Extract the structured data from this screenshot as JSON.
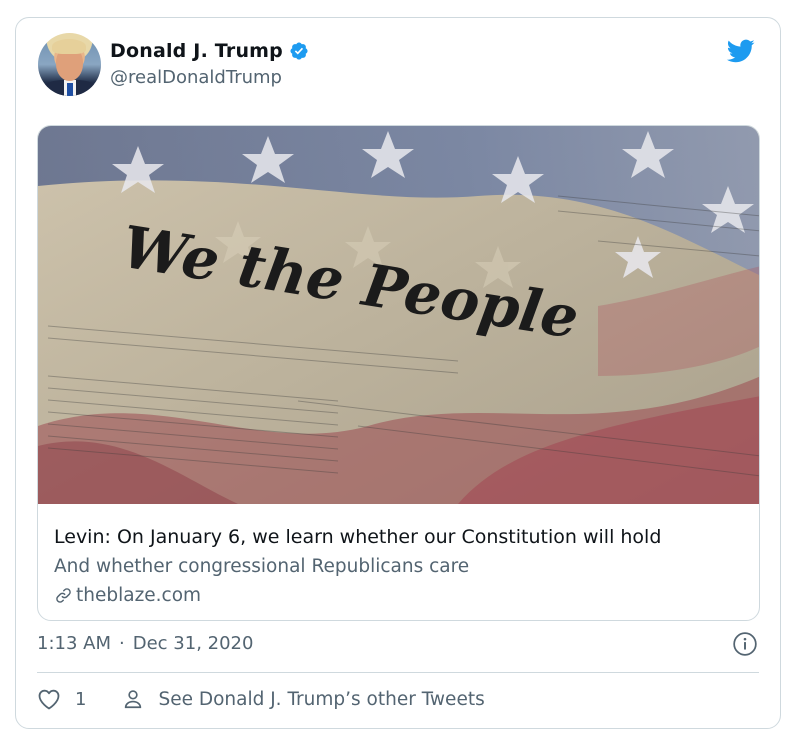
{
  "tweet": {
    "author": {
      "display_name": "Donald J. Trump",
      "handle": "@realDonaldTrump",
      "verified": true,
      "verified_icon": "verified-badge-icon"
    },
    "brand_icon": "twitter-bird-icon",
    "link_card": {
      "image_text": "We the People",
      "title": "Levin: On January 6, we learn whether our Constitution will hold",
      "description": "And whether congressional Republicans care",
      "domain": "theblaze.com",
      "domain_icon": "link-icon"
    },
    "time": "1:13 AM",
    "separator": "·",
    "date": "Dec 31, 2020",
    "info_icon": "info-icon",
    "actions": {
      "like_icon": "heart-icon",
      "like_count": "1",
      "profile_icon": "person-icon",
      "profile_label": "See Donald J. Trump’s other Tweets"
    }
  },
  "colors": {
    "twitter_blue": "#1d9bf0",
    "text_primary": "#0f1419",
    "text_secondary": "#536471",
    "border": "#cfd9de"
  }
}
